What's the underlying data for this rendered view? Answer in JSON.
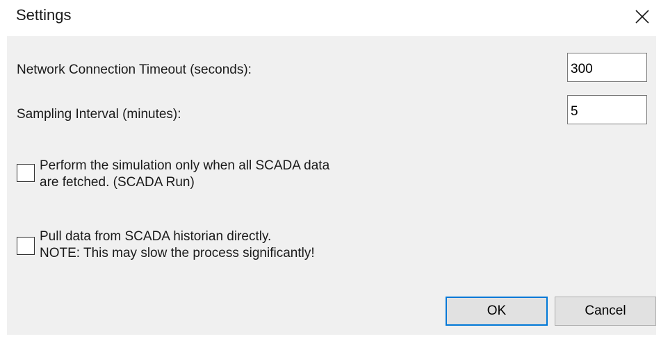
{
  "window": {
    "title": "Settings",
    "close_glyph": "×"
  },
  "fields": {
    "timeout": {
      "label": "Network Connection Timeout (seconds):",
      "value": "300"
    },
    "sampling": {
      "label": "Sampling Interval (minutes):",
      "value": "5"
    }
  },
  "checkboxes": [
    {
      "line1": "Perform the simulation only when all SCADA data",
      "line2": "are fetched. (SCADA Run)",
      "checked": false
    },
    {
      "line1": "Pull data from SCADA historian directly.",
      "line2": "NOTE: This may slow the process significantly!",
      "checked": false
    }
  ],
  "buttons": {
    "ok": "OK",
    "cancel": "Cancel"
  },
  "icons": {
    "close": "close-icon"
  },
  "colors": {
    "client_bg": "#f0f0f0",
    "default_button_border": "#0078d7",
    "button_bg": "#e1e1e1"
  }
}
